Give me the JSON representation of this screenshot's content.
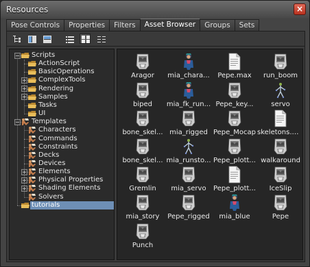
{
  "window": {
    "title": "Resources",
    "close_glyph": "×"
  },
  "tabs": [
    {
      "label": "Pose Controls",
      "active": false
    },
    {
      "label": "Properties",
      "active": false
    },
    {
      "label": "Filters",
      "active": false
    },
    {
      "label": "Asset Browser",
      "active": true
    },
    {
      "label": "Groups",
      "active": false
    },
    {
      "label": "Sets",
      "active": false
    }
  ],
  "toolbar": {
    "buttons": [
      {
        "icon": "tree-expand-icon",
        "pressed": false
      },
      {
        "icon": "split-vertical-icon",
        "pressed": false
      },
      {
        "icon": "split-horizontal-icon",
        "pressed": false
      },
      {
        "icon": "details-view-icon",
        "pressed": false
      },
      {
        "icon": "icon-view-icon",
        "pressed": true
      },
      {
        "icon": "list-view-icon",
        "pressed": false
      }
    ]
  },
  "tree": [
    {
      "label": "Scripts",
      "level": 0,
      "expander": "−",
      "icon": "folder"
    },
    {
      "label": "ActionScript",
      "level": 1,
      "expander": "",
      "icon": "folder"
    },
    {
      "label": "BasicOperations",
      "level": 1,
      "expander": "",
      "icon": "folder"
    },
    {
      "label": "ComplexTools",
      "level": 1,
      "expander": "+",
      "icon": "folder"
    },
    {
      "label": "Rendering",
      "level": 1,
      "expander": "+",
      "icon": "folder"
    },
    {
      "label": "Samples",
      "level": 1,
      "expander": "+",
      "icon": "folder"
    },
    {
      "label": "Tasks",
      "level": 1,
      "expander": "",
      "icon": "folder"
    },
    {
      "label": "UI",
      "level": 1,
      "expander": "",
      "icon": "folder"
    },
    {
      "label": "Templates",
      "level": 0,
      "expander": "−",
      "icon": "template"
    },
    {
      "label": "Characters",
      "level": 1,
      "expander": "",
      "icon": "template"
    },
    {
      "label": "Commands",
      "level": 1,
      "expander": "",
      "icon": "template"
    },
    {
      "label": "Constraints",
      "level": 1,
      "expander": "",
      "icon": "template"
    },
    {
      "label": "Decks",
      "level": 1,
      "expander": "",
      "icon": "template"
    },
    {
      "label": "Devices",
      "level": 1,
      "expander": "",
      "icon": "template"
    },
    {
      "label": "Elements",
      "level": 1,
      "expander": "+",
      "icon": "template"
    },
    {
      "label": "Physical Properties",
      "level": 1,
      "expander": "+",
      "icon": "template"
    },
    {
      "label": "Shading Elements",
      "level": 1,
      "expander": "+",
      "icon": "template"
    },
    {
      "label": "Solvers",
      "level": 1,
      "expander": "",
      "icon": "template"
    },
    {
      "label": "tutorials",
      "level": 0,
      "expander": "",
      "icon": "folder",
      "selected": true
    }
  ],
  "assets": [
    {
      "name": "Aragor",
      "icon": "fbx"
    },
    {
      "name": "mia_chara...",
      "icon": "character"
    },
    {
      "name": "Pepe.max",
      "icon": "document"
    },
    {
      "name": "run_boom",
      "icon": "fbx"
    },
    {
      "name": "biped",
      "icon": "fbx"
    },
    {
      "name": "mia_fk_run...",
      "icon": "character"
    },
    {
      "name": "Pepe_key...",
      "icon": "fbx"
    },
    {
      "name": "servo",
      "icon": "skeleton"
    },
    {
      "name": "bone_skel...",
      "icon": "fbx"
    },
    {
      "name": "mia_rigged",
      "icon": "fbx"
    },
    {
      "name": "Pepe_Mocap",
      "icon": "fbx"
    },
    {
      "name": "skeletons.m...",
      "icon": "document"
    },
    {
      "name": "bone_skel...",
      "icon": "fbx"
    },
    {
      "name": "mia_runsto...",
      "icon": "skeleton"
    },
    {
      "name": "Pepe_plott...",
      "icon": "fbx"
    },
    {
      "name": "walkaround",
      "icon": "fbx"
    },
    {
      "name": "Gremlin",
      "icon": "fbx"
    },
    {
      "name": "mia_servo",
      "icon": "fbx"
    },
    {
      "name": "Pepe_plott...",
      "icon": "document"
    },
    {
      "name": "IceSlip",
      "icon": "fbx"
    },
    {
      "name": "mia_story",
      "icon": "fbx"
    },
    {
      "name": "Pepe_rigged",
      "icon": "fbx"
    },
    {
      "name": "mia_blue",
      "icon": "character"
    },
    {
      "name": "Pepe",
      "icon": "fbx"
    },
    {
      "name": "Punch",
      "icon": "fbx"
    }
  ],
  "colors": {
    "selection": "#6e8fb6",
    "folder": "#e0b452",
    "template": "#c98a5a"
  }
}
